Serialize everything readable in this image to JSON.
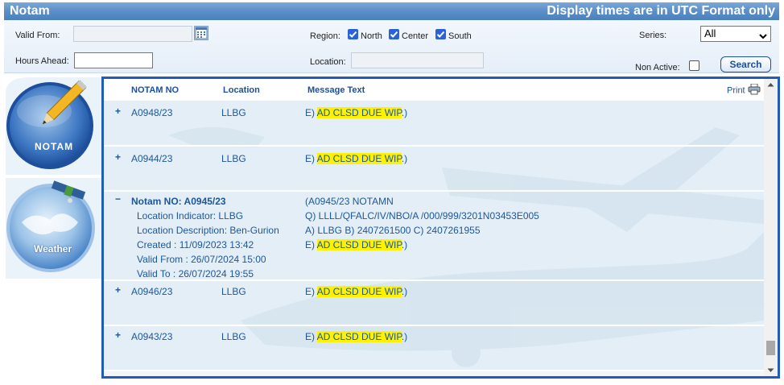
{
  "header": {
    "title": "Notam",
    "note": "Display times are in UTC Format only"
  },
  "filters": {
    "valid_from_label": "Valid From:",
    "hours_ahead_label": "Hours Ahead:",
    "region_label": "Region:",
    "regions": [
      {
        "label": "North",
        "checked": true
      },
      {
        "label": "Center",
        "checked": true
      },
      {
        "label": "South",
        "checked": true
      }
    ],
    "location_label": "Location:",
    "series_label": "Series:",
    "series_value": "All",
    "non_active_label": "Non Active:",
    "search_label": "Search"
  },
  "sidebar": {
    "notam_label": "NOTAM",
    "weather_label": "Weather"
  },
  "table": {
    "columns": [
      "NOTAM NO",
      "Location",
      "Message Text"
    ],
    "print_label": "Print",
    "rows": [
      {
        "toggle": "+",
        "no": "A0948/23",
        "location": "LLBG",
        "msg_prefix": "E)",
        "msg_hl": "AD CLSD DUE WIP",
        "msg_suffix": ".)"
      },
      {
        "toggle": "+",
        "no": "A0944/23",
        "location": "LLBG",
        "msg_prefix": "E)",
        "msg_hl": "AD CLSD DUE WIP",
        "msg_suffix": ".)"
      },
      {
        "toggle": "+",
        "no": "A0946/23",
        "location": "LLBG",
        "msg_prefix": "E)",
        "msg_hl": "AD CLSD DUE WIP",
        "msg_suffix": ".)"
      },
      {
        "toggle": "+",
        "no": "A0943/23",
        "location": "LLBG",
        "msg_prefix": "E)",
        "msg_hl": "AD CLSD DUE WIP",
        "msg_suffix": ".)"
      }
    ],
    "expanded": {
      "toggle": "−",
      "title": "Notam NO: A0945/23",
      "location_indicator": "Location Indicator:  LLBG",
      "location_description": "Location Description:  Ben-Gurion",
      "created": "Created :     11/09/2023 13:42",
      "valid_from": "Valid From :  26/07/2024 15:00",
      "valid_to": "Valid To :      26/07/2024 19:55",
      "line1": "(A0945/23 NOTAMN",
      "line2": "Q) LLLL/QFALC/IV/NBO/A /000/999/3201N03453E005",
      "line3": "A) LLBG B) 2407261500 C) 2407261955",
      "msg_prefix": "E)",
      "msg_hl": "AD CLSD DUE WIP",
      "msg_suffix": ".)"
    }
  },
  "colors": {
    "accent": "#1f5db8",
    "header_bg": "#5b8fc8",
    "highlight": "#fff200",
    "text_blue": "#1d5799"
  }
}
